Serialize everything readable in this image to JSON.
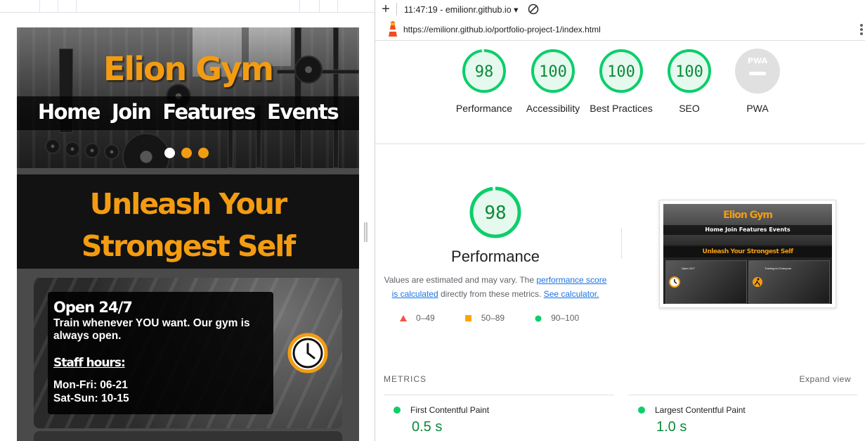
{
  "site": {
    "title": "Elion Gym",
    "nav": [
      "Home",
      "Join",
      "Features",
      "Events"
    ],
    "tagline": "Unleash Your Strongest Self",
    "card": {
      "heading": "Open 24/7",
      "body": "Train whenever YOU want. Our gym is always open.",
      "staff_heading": "Staff hours:",
      "hours": [
        "Mon-Fri: 06-21",
        "Sat-Sun: 10-15"
      ]
    },
    "carousel": {
      "count": 3,
      "active_index": 0
    },
    "brand_color": "#f39c12"
  },
  "toolbar": {
    "add_icon": "+",
    "report_selector": "11:47:19 - emilionr.github.io",
    "dropdown_glyph": "▾",
    "url": "https://emilionr.github.io/portfolio-project-1/index.html"
  },
  "scores": [
    {
      "label": "Performance",
      "value": "98",
      "fraction": 0.98
    },
    {
      "label": "Accessibility",
      "value": "100",
      "fraction": 1.0
    },
    {
      "label": "Best Practices",
      "value": "100",
      "fraction": 1.0
    },
    {
      "label": "SEO",
      "value": "100",
      "fraction": 1.0
    },
    {
      "label": "PWA",
      "value": "",
      "badge": "PWA"
    }
  ],
  "performance": {
    "score": "98",
    "score_fraction": 0.98,
    "title": "Performance",
    "desc_prefix": "Values are estimated and may vary. The ",
    "desc_link1": "performance score is calculated",
    "desc_mid": " directly from these metrics. ",
    "desc_link2": "See calculator."
  },
  "legend": [
    {
      "range": "0–49",
      "shape": "triangle",
      "color": "#ff4e42"
    },
    {
      "range": "50–89",
      "shape": "square",
      "color": "#ffa400"
    },
    {
      "range": "90–100",
      "shape": "circle",
      "color": "#0cce6b"
    }
  ],
  "thumbnail": {
    "title": "Elion Gym",
    "nav": "Home Join Features Events",
    "tagline": "Unleash Your Strongest Self",
    "card1": "Open 24/7",
    "card2": "Training for Everyone"
  },
  "metrics": {
    "title": "METRICS",
    "expand": "Expand view",
    "items": [
      {
        "name": "First Contentful Paint",
        "value": "0.5 s"
      },
      {
        "name": "Largest Contentful Paint",
        "value": "1.0 s"
      }
    ]
  },
  "colors": {
    "pass": "#0cce6b",
    "pass_text": "#0a8a3a",
    "pass_fill": "#e6f9ee",
    "na_fill": "#e0e0e0"
  }
}
